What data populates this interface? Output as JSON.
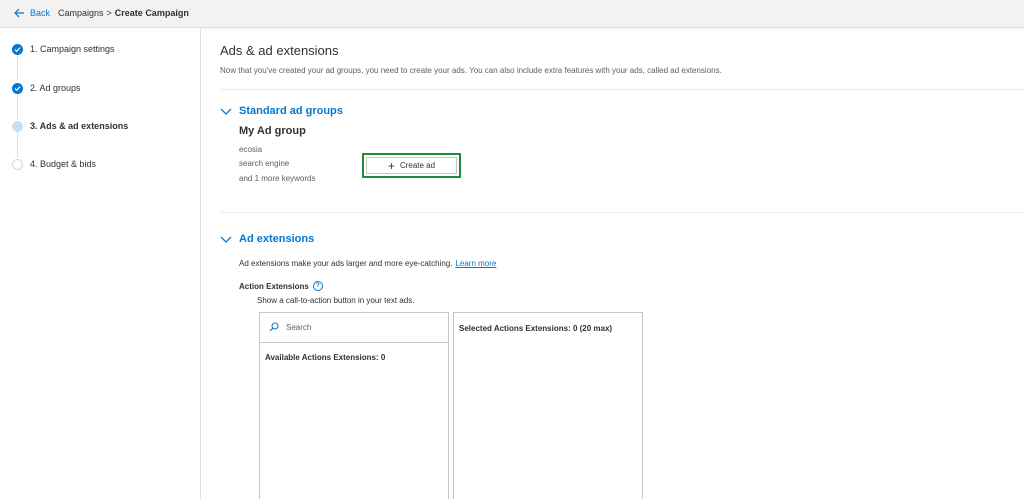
{
  "topbar": {
    "back_label": "Back",
    "breadcrumb": [
      "Campaigns",
      "Create Campaign"
    ],
    "separator": ">"
  },
  "steps": [
    {
      "label": "1. Campaign settings",
      "status": "done"
    },
    {
      "label": "2. Ad groups",
      "status": "done"
    },
    {
      "label": "3. Ads & ad extensions",
      "status": "current"
    },
    {
      "label": "4. Budget & bids",
      "status": "todo"
    }
  ],
  "main": {
    "title": "Ads & ad extensions",
    "description": "Now that you've created your ad groups, you need to create your ads. You can also include extra features with your ads, called ad extensions.",
    "standard_section": {
      "title": "Standard ad groups",
      "group_name": "My Ad group",
      "keywords": [
        "ecosia",
        "search engine",
        "and 1 more keywords"
      ],
      "create_ad_label": "Create ad"
    },
    "extensions_section": {
      "title": "Ad extensions",
      "description": "Ad extensions make your ads larger and more eye-catching.",
      "learn_more": "Learn more",
      "action_title": "Action Extensions",
      "info_glyph": "?",
      "action_desc": "Show a call-to-action button in your text ads.",
      "search_placeholder": "Search",
      "available_label": "Available Actions Extensions:  0",
      "selected_label": "Selected Actions Extensions:  0 (20 max)"
    }
  },
  "colors": {
    "accent": "#0078d4",
    "highlight": "#1e8c3a",
    "current_step": "#c7e0f4"
  },
  "icons": {
    "back": "arrow-left-icon",
    "step_done": "checkmark-icon",
    "section": "chevron-down-icon",
    "add": "plus-icon",
    "search": "search-icon",
    "info": "info-icon"
  }
}
